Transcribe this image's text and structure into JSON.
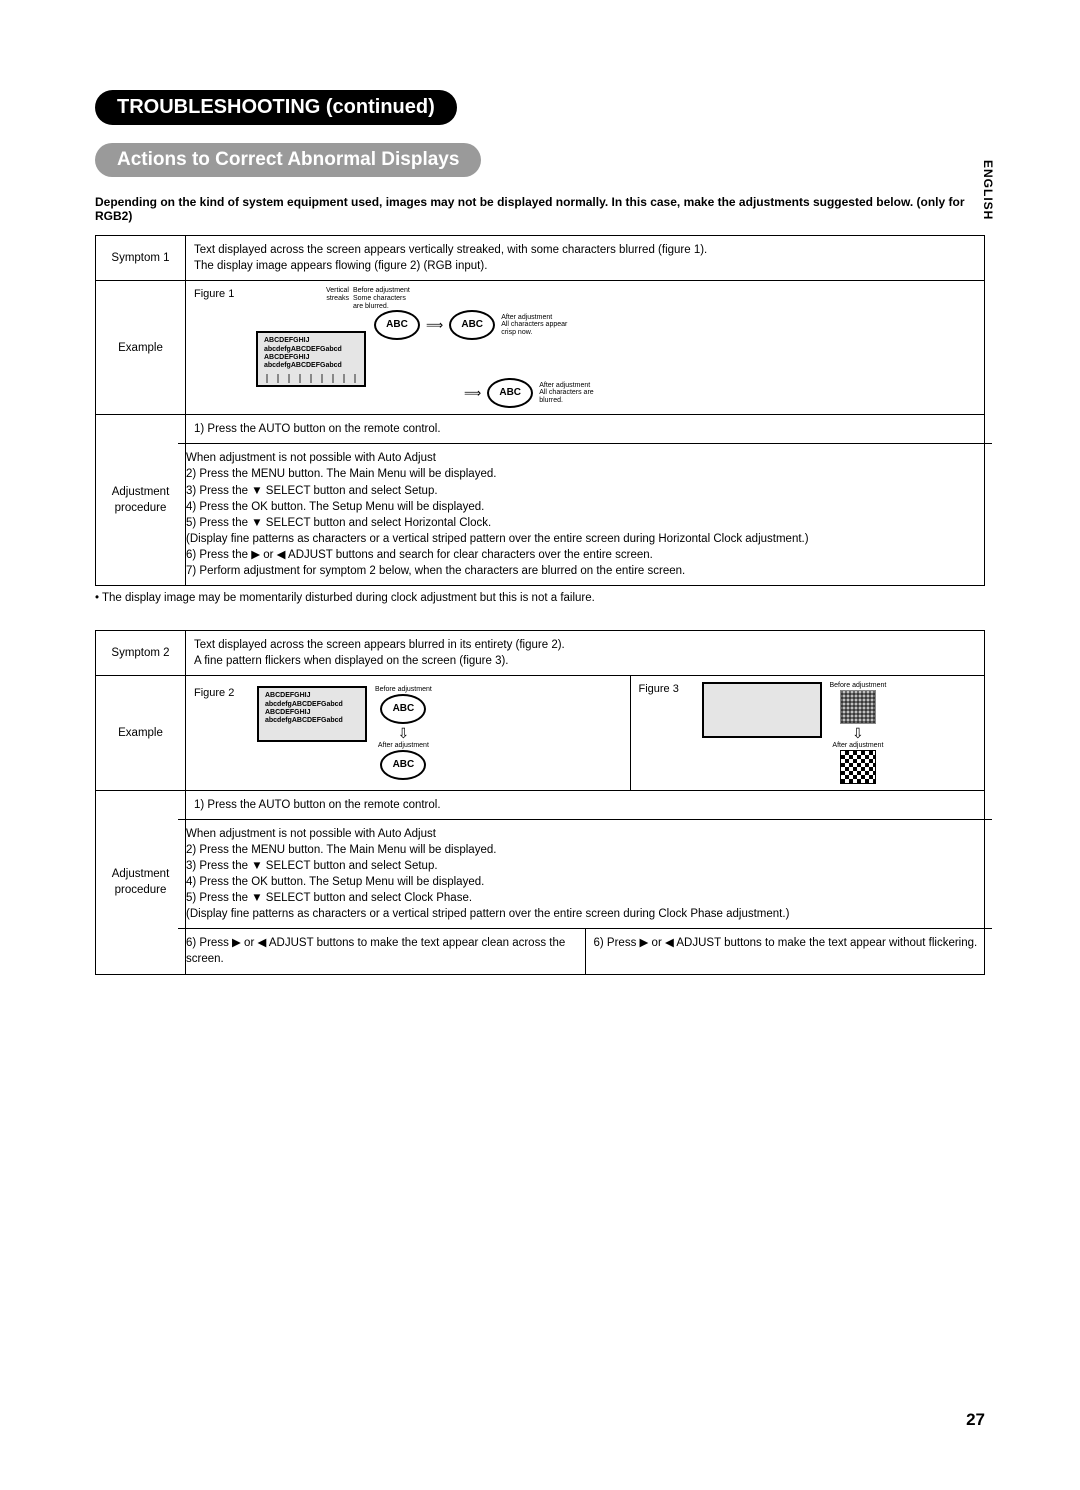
{
  "side_tab": "ENGLISH",
  "page_number": "27",
  "heading_black": "TROUBLESHOOTING (continued)",
  "heading_gray": "Actions to Correct Abnormal Displays",
  "intro": "Depending on the kind of system equipment used, images may not be displayed normally.  In this case, make the adjustments suggested below. (only for RGB2)",
  "t1": {
    "symptom_label": "Symptom 1",
    "symptom_text": "Text displayed across the screen appears vertically streaked, with some characters blurred (figure 1).\nThe display image appears flowing (figure 2) (RGB input).",
    "example_label": "Example",
    "fig1_label": "Figure 1",
    "fig1_box_lines": "ABCDEFGHIJ\nabcdefgABCDEFGabcd\nABCDEFGHIJ\nabcdefgABCDEFGabcd",
    "fig1_note_top": "Vertical\nstreaks",
    "fig1_note_before": "Before adjustment\nSome characters\nare blurred.",
    "fig1_abc": "ABC",
    "fig1_after1": "After adjustment\nAll characters appear\ncrisp now.",
    "fig1_after2": "After adjustment\nAll characters are\nblurred.",
    "adj_label": "Adjustment\nprocedure",
    "adj_step1": "1) Press the AUTO button on the remote control.",
    "adj_rest": "When adjustment is not possible with Auto Adjust\n2) Press the MENU button. The Main Menu will be displayed.\n3) Press the ▼ SELECT button and select Setup.\n4) Press the OK button. The Setup Menu will be displayed.\n5) Press the ▼ SELECT button and select Horizontal Clock.\n(Display fine patterns as characters or a vertical striped pattern over the entire screen during Horizontal Clock adjustment.)\n6) Press the ▶ or ◀ ADJUST buttons and search for clear characters over the entire screen.\n7) Perform adjustment for symptom 2 below, when the characters are blurred on the entire screen."
  },
  "note_between": "• The display image may be momentarily disturbed during clock adjustment but this is not a failure.",
  "t2": {
    "symptom_label": "Symptom 2",
    "symptom_text": "Text displayed across the screen appears blurred in its entirety (figure 2).\nA fine pattern flickers when displayed on the screen (figure 3).",
    "example_label": "Example",
    "fig2_label": "Figure 2",
    "fig2_box_lines": "ABCDEFGHIJ\nabcdefgABCDEFGabcd\nABCDEFGHIJ\nabcdefgABCDEFGabcd",
    "fig2_before": "Before adjustment",
    "fig2_after": "After adjustment",
    "fig2_abc": "ABC",
    "fig3_label": "Figure 3",
    "fig3_before": "Before adjustment",
    "fig3_after": "After adjustment",
    "adj_label": "Adjustment\nprocedure",
    "adj_step1": "1) Press the AUTO button on the remote control.",
    "adj_rest": "When adjustment is not possible with Auto Adjust\n2) Press the MENU button. The Main Menu will be displayed.\n3) Press the ▼ SELECT button and select Setup.\n4) Press the OK button. The Setup Menu will be displayed.\n5) Press the ▼ SELECT button and select Clock Phase.\n(Display fine patterns as characters or a vertical striped pattern over the entire screen during Clock Phase adjustment.)",
    "adj_left": "6) Press ▶ or ◀ ADJUST buttons to make the text appear clean across the screen.",
    "adj_right": "6) Press ▶ or ◀ ADJUST buttons to make the text appear without flickering."
  }
}
